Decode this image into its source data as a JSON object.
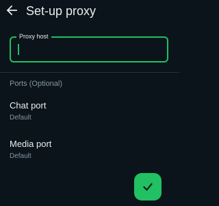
{
  "app_bar": {
    "title": "Set-up proxy"
  },
  "proxy_host": {
    "label": "Proxy host",
    "value": "",
    "placeholder": ""
  },
  "ports_section": {
    "header": "Ports (Optional)",
    "items": [
      {
        "title": "Chat port",
        "value": "Default"
      },
      {
        "title": "Media port",
        "value": "Default"
      }
    ]
  },
  "icons": {
    "back": "arrow-left-icon",
    "confirm": "check-icon"
  },
  "colors": {
    "background": "#0b141a",
    "accent": "#21c063",
    "primary_text": "#e9edef",
    "secondary_text": "#8696a0"
  }
}
